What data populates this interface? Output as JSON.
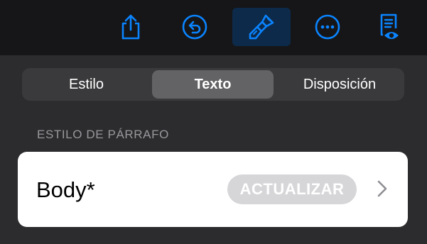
{
  "toolbar": {
    "buttons": [
      {
        "icon": "share-icon"
      },
      {
        "icon": "undo-icon"
      },
      {
        "icon": "format-brush-icon",
        "active": true
      },
      {
        "icon": "more-icon"
      },
      {
        "icon": "reading-view-icon"
      }
    ],
    "accent_color": "#0a84ff"
  },
  "format_panel": {
    "tabs": [
      {
        "label": "Estilo",
        "selected": false
      },
      {
        "label": "Texto",
        "selected": true
      },
      {
        "label": "Disposición",
        "selected": false
      }
    ],
    "section_header": "ESTILO DE PÁRRAFO",
    "paragraph_style": {
      "name": "Body*",
      "update_label": "ACTUALIZAR"
    }
  }
}
